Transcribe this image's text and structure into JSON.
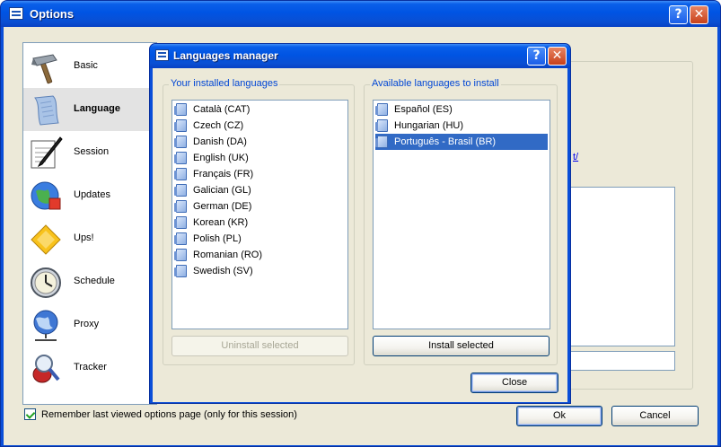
{
  "options_window": {
    "title": "Options",
    "help_glyph": "?",
    "close_glyph": "✕",
    "sidebar": [
      {
        "label": "Basic",
        "icon": "hammer-icon"
      },
      {
        "label": "Language",
        "icon": "scroll-icon",
        "selected": true
      },
      {
        "label": "Session",
        "icon": "pen-paper-icon"
      },
      {
        "label": "Updates",
        "icon": "globe-update-icon"
      },
      {
        "label": "Ups!",
        "icon": "shield-warning-icon"
      },
      {
        "label": "Schedule",
        "icon": "clock-icon"
      },
      {
        "label": "Proxy",
        "icon": "network-globe-icon"
      },
      {
        "label": "Tracker",
        "icon": "bug-magnifier-icon"
      }
    ],
    "link_fragment": "t/",
    "remember_label": "Remember last viewed options page (only for this session)",
    "remember_checked": true,
    "ok_label": "Ok",
    "cancel_label": "Cancel"
  },
  "languages_manager": {
    "title": "Languages manager",
    "help_glyph": "?",
    "close_glyph": "✕",
    "installed_legend": "Your installed languages",
    "installed": [
      "Català (CAT)",
      "Czech (CZ)",
      "Danish (DA)",
      "English (UK)",
      "Français (FR)",
      "Galician (GL)",
      "German (DE)",
      "Korean (KR)",
      "Polish (PL)",
      "Romanian (RO)",
      "Swedish (SV)"
    ],
    "available_legend": "Available languages to install",
    "available": [
      "Español (ES)",
      "Hungarian (HU)",
      "Português - Brasil (BR)"
    ],
    "available_selected_index": 2,
    "uninstall_label": "Uninstall selected",
    "install_label": "Install selected",
    "close_label": "Close"
  },
  "colors": {
    "titlebar": "#0054e3",
    "selection": "#316ac5",
    "group_legend": "#0046d5",
    "dialog_face": "#ece9d8"
  }
}
